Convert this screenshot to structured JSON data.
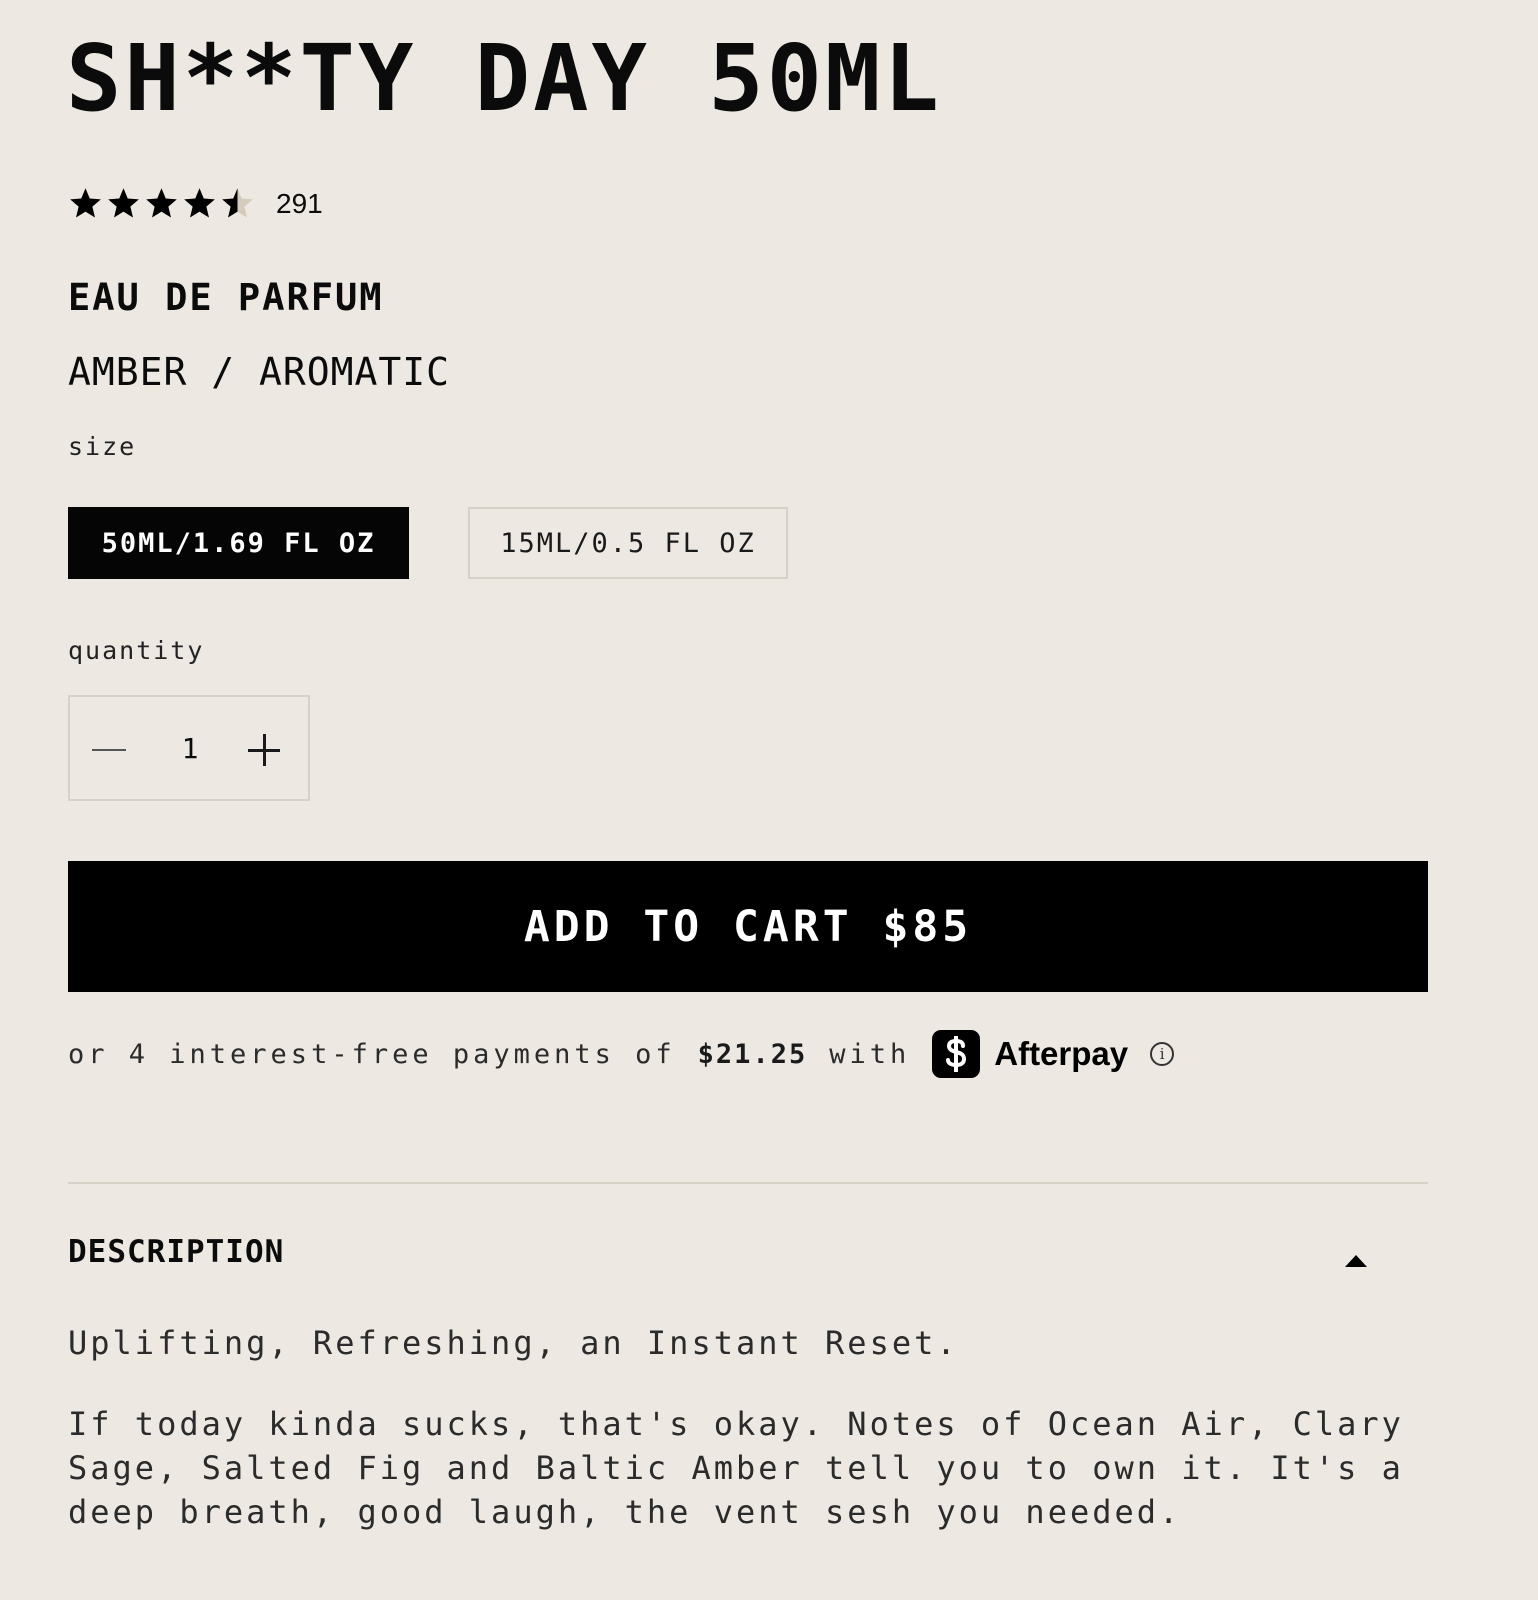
{
  "product": {
    "title": "SH**TY DAY 50ML",
    "rating": 4.5,
    "rating_max": 5,
    "review_count": "291",
    "type": "EAU DE PARFUM",
    "scent_family": "AMBER / AROMATIC"
  },
  "size": {
    "label": "size",
    "options": [
      {
        "label": "50ML/1.69 FL OZ",
        "selected": true
      },
      {
        "label": "15ML/0.5 FL OZ",
        "selected": false
      }
    ]
  },
  "quantity": {
    "label": "quantity",
    "value": "1"
  },
  "cart": {
    "label": "ADD TO CART $85"
  },
  "installments": {
    "prefix": "or 4 interest-free payments of",
    "amount": "$21.25",
    "suffix": "with",
    "provider": "Afterpay"
  },
  "description": {
    "heading": "DESCRIPTION",
    "expanded": true,
    "tagline": "Uplifting, Refreshing, an Instant Reset.",
    "body": "If today kinda sucks, that's okay. Notes of Ocean Air, Clary Sage, Salted Fig and Baltic Amber tell you to own it. It's a deep breath, good laugh, the vent sesh you needed."
  },
  "icons": {
    "star": "star-icon",
    "minus": "minus-icon",
    "plus": "plus-icon",
    "afterpay": "afterpay-logo-icon",
    "info": "info-icon",
    "caret": "caret-up-icon"
  },
  "colors": {
    "background": "#ede9e2",
    "primary": "#000000",
    "border": "#d7d2c8",
    "star_empty": "#d4cbbd"
  }
}
